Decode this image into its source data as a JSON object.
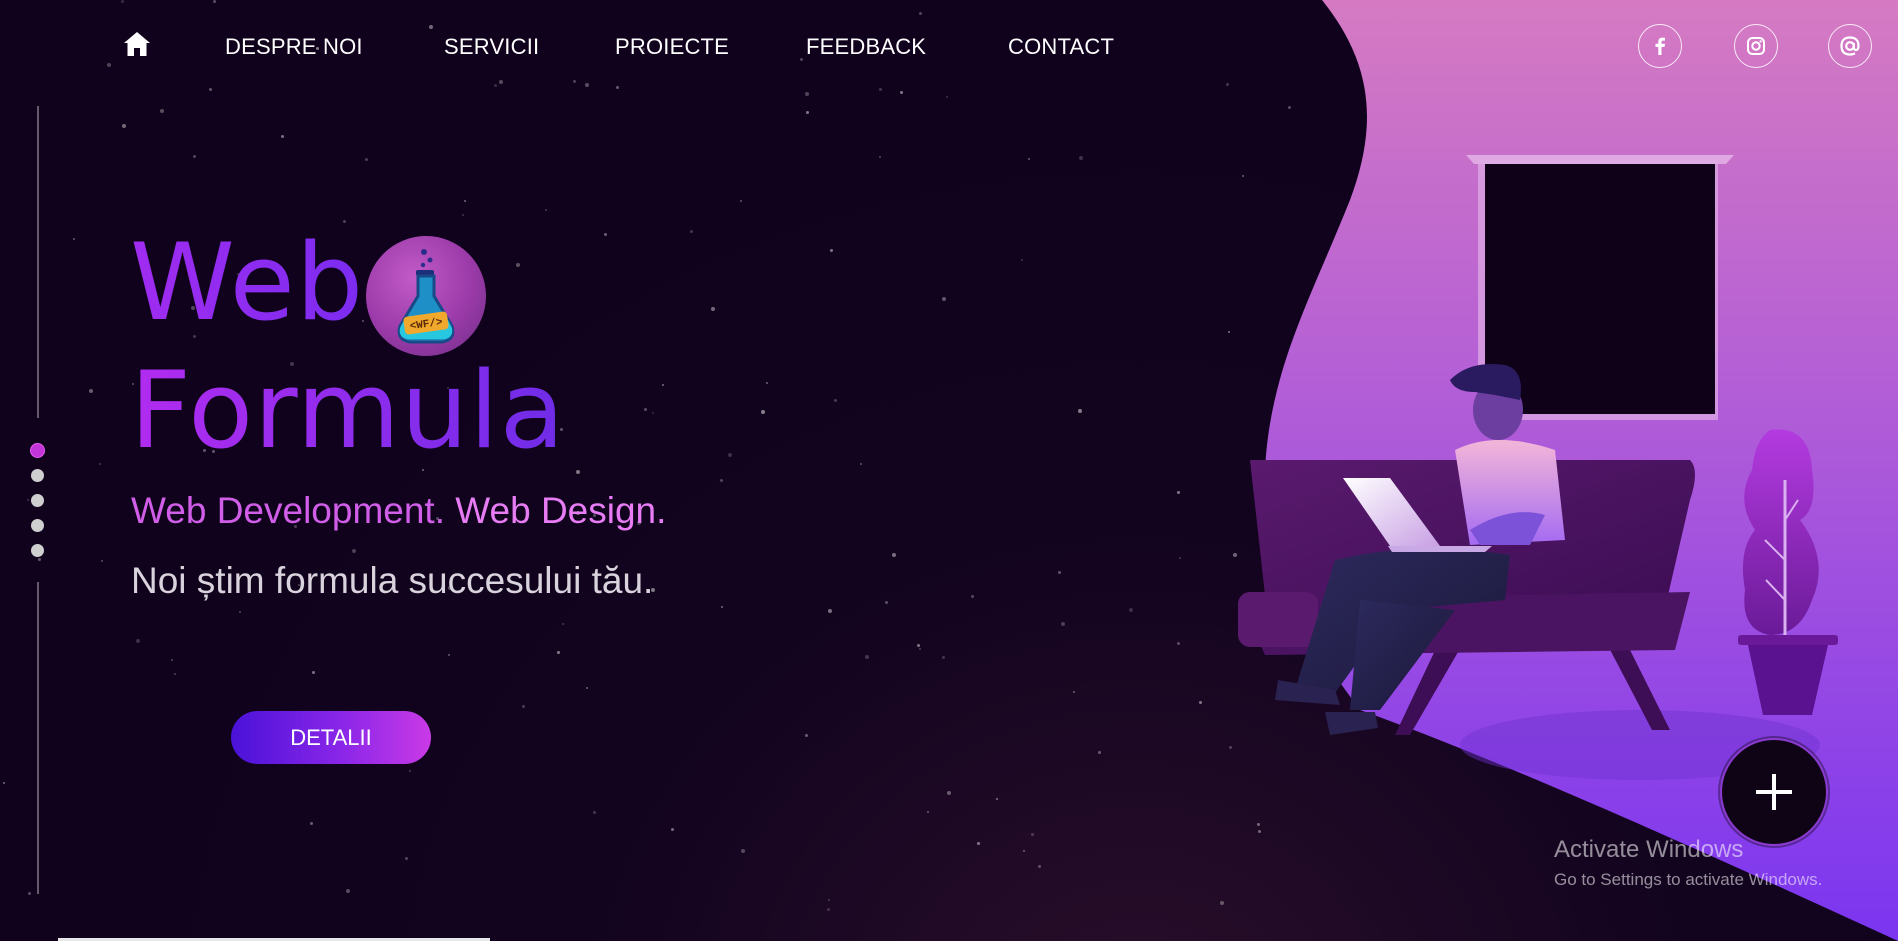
{
  "nav": {
    "home_icon": "home-icon",
    "links": [
      "DESPRE NOI",
      "SERVICII",
      "PROIECTE",
      "FEEDBACK",
      "CONTACT"
    ]
  },
  "social": {
    "icons": [
      "facebook-icon",
      "instagram-icon",
      "at-icon"
    ]
  },
  "hero": {
    "brand_line1": "Web",
    "brand_line2": "Formula",
    "logo_icon": "flask-logo-icon",
    "logo_text": "<WF/>",
    "tagline_part1": "Web Development.",
    "tagline_part2": "Web Design.",
    "subtitle": "Noi știm formula succesului tău.",
    "cta_label": "DETALII"
  },
  "scroller": {
    "active_index": 0,
    "count": 5
  },
  "fab": {
    "icon": "plus-icon"
  },
  "watermark": {
    "line1": "Activate Windows",
    "line2": "Go to Settings to activate Windows."
  },
  "colors": {
    "background": "#10021c",
    "accent_purple": "#a12cf0",
    "accent_pink": "#d15ee8",
    "cta_start": "#4a12d8",
    "cta_end": "#c93ae6"
  }
}
